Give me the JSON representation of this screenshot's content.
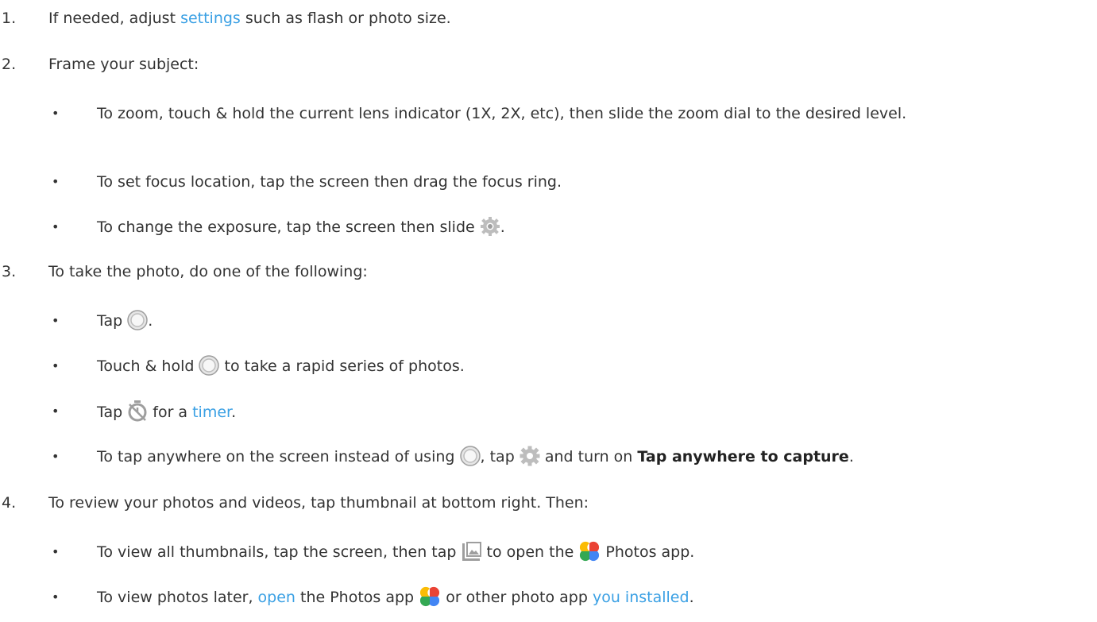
{
  "steps": [
    {
      "num": "1.",
      "pre": "If needed, adjust ",
      "link": "settings",
      "post": " such as flash or photo size."
    },
    {
      "num": "2.",
      "text": "Frame your subject:"
    },
    {
      "num": "3.",
      "text": "To take the photo, do one of the following:"
    },
    {
      "num": "4.",
      "text": "To review your photos and videos, tap thumbnail at bottom right. Then:"
    }
  ],
  "bullets": {
    "zoom": "To zoom, touch & hold the current lens indicator (1X, 2X, etc), then slide the zoom dial to the desired level.",
    "focus": "To set focus location, tap the screen then drag the focus ring.",
    "exposure_pre": "To change the exposure, tap the screen then slide ",
    "exposure_post": ".",
    "tap_pre": "Tap ",
    "tap_post": ".",
    "hold_pre": "Touch & hold ",
    "hold_post": " to take a rapid series of photos.",
    "timer_pre": "Tap ",
    "timer_mid": " for a ",
    "timer_link": "timer",
    "timer_post": ".",
    "anywhere_pre": "To tap anywhere on the screen instead of using ",
    "anywhere_mid1": ", tap ",
    "anywhere_mid2": " and turn on ",
    "anywhere_bold": "Tap anywhere to capture",
    "anywhere_post": ".",
    "viewall_pre": "To view all thumbnails, tap the screen, then tap ",
    "viewall_mid": " to open the ",
    "viewall_post": " Photos app.",
    "later_pre": "To view photos later, ",
    "later_link1": "open",
    "later_mid": " the Photos app ",
    "later_mid2": " or other photo app ",
    "later_link2": "you installed",
    "later_post": "."
  },
  "bullet_char": "•",
  "colors": {
    "link": "#3aa0e4",
    "text": "#333333"
  }
}
